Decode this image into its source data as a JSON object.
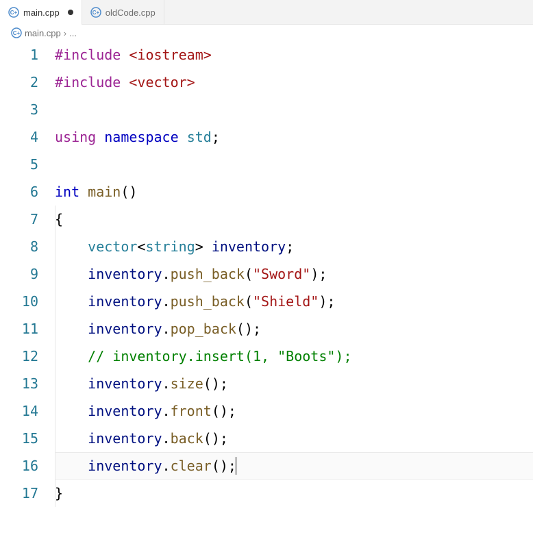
{
  "tabs": [
    {
      "label": "main.cpp",
      "active": true,
      "dirty": true
    },
    {
      "label": "oldCode.cpp",
      "active": false,
      "dirty": false
    }
  ],
  "breadcrumb": {
    "file": "main.cpp",
    "sep": "›",
    "more": "..."
  },
  "lineNumbers": [
    "1",
    "2",
    "3",
    "4",
    "5",
    "6",
    "7",
    "8",
    "9",
    "10",
    "11",
    "12",
    "13",
    "14",
    "15",
    "16",
    "17"
  ],
  "code": {
    "l1": {
      "include": "#include",
      "target": "<iostream>"
    },
    "l2": {
      "include": "#include",
      "target": "<vector>"
    },
    "l3": {
      "blank": ""
    },
    "l4": {
      "using": "using",
      "namespace": "namespace",
      "name": "std",
      "semi": ";"
    },
    "l5": {
      "blank": ""
    },
    "l6": {
      "type": "int",
      "func": "main",
      "parens": "()"
    },
    "l7": {
      "brace": "{"
    },
    "l8": {
      "class1": "vector",
      "lt": "<",
      "class2": "string",
      "gt": ">",
      "sp": " ",
      "var": "inventory",
      "semi": ";"
    },
    "l9": {
      "var": "inventory",
      "dot": ".",
      "method": "push_back",
      "open": "(",
      "str": "\"Sword\"",
      "close": ")",
      "semi": ";"
    },
    "l10": {
      "var": "inventory",
      "dot": ".",
      "method": "push_back",
      "open": "(",
      "str": "\"Shield\"",
      "close": ")",
      "semi": ";"
    },
    "l11": {
      "var": "inventory",
      "dot": ".",
      "method": "pop_back",
      "open": "(",
      "close": ")",
      "semi": ";"
    },
    "l12": {
      "comment": "// inventory.insert(1, \"Boots\");"
    },
    "l13": {
      "var": "inventory",
      "dot": ".",
      "method": "size",
      "open": "(",
      "close": ")",
      "semi": ";"
    },
    "l14": {
      "var": "inventory",
      "dot": ".",
      "method": "front",
      "open": "(",
      "close": ")",
      "semi": ";"
    },
    "l15": {
      "var": "inventory",
      "dot": ".",
      "method": "back",
      "open": "(",
      "close": ")",
      "semi": ";"
    },
    "l16": {
      "var": "inventory",
      "dot": ".",
      "method": "clear",
      "open": "(",
      "close": ")",
      "semi": ";"
    },
    "l17": {
      "brace": "}"
    }
  },
  "indent": "    "
}
